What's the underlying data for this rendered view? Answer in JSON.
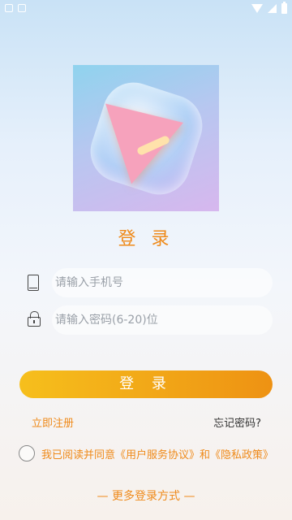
{
  "status_bar": {
    "icons": [
      "notification-icon",
      "notification-icon",
      "wifi-icon",
      "signal-icon",
      "battery-icon"
    ]
  },
  "logo": {
    "icon": "app-logo"
  },
  "title": "登 录",
  "phone": {
    "placeholder": "请输入手机号",
    "value": ""
  },
  "password": {
    "placeholder": "请输入密码(6-20)位",
    "value": ""
  },
  "login_button": "登 录",
  "register_link": "立即注册",
  "forgot_link": "忘记密码?",
  "agreement": {
    "text": "我已阅读并同意《用户服务协议》和《隐私政策》",
    "checked": false
  },
  "more_login": "— 更多登录方式 —",
  "colors": {
    "accent": "#ef8a1a",
    "button_start": "#f6bf1c",
    "button_end": "#ee9213"
  }
}
